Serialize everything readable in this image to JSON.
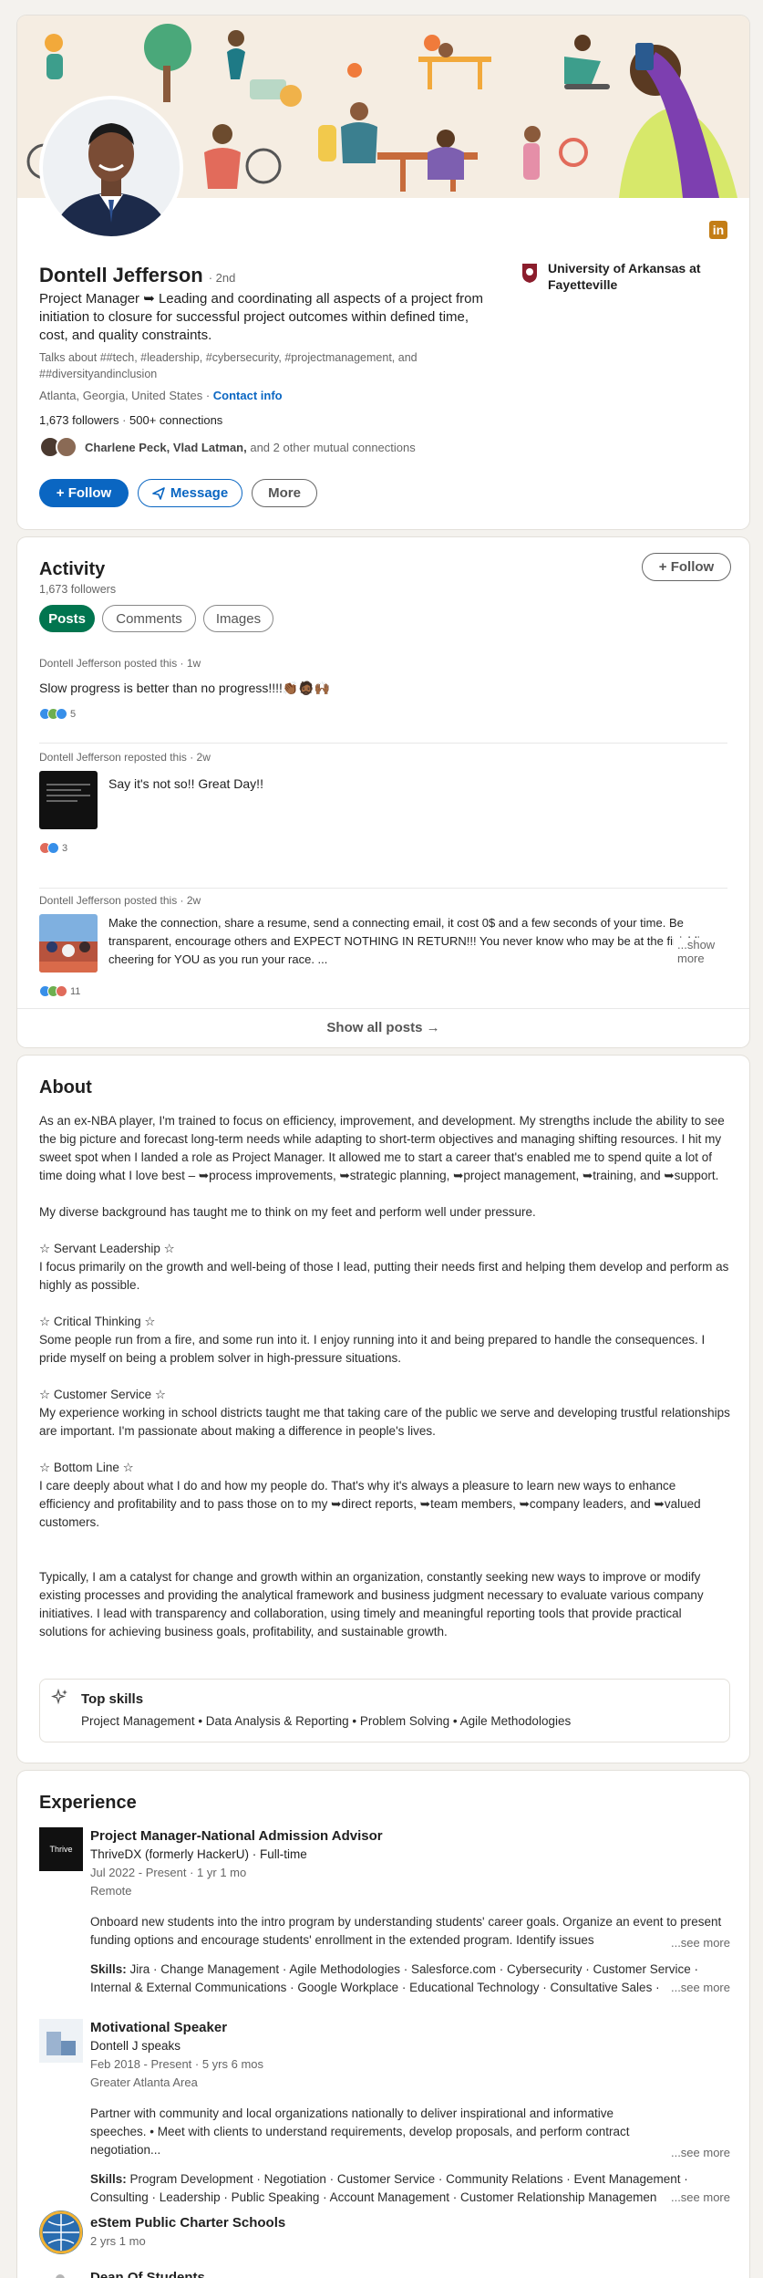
{
  "profile": {
    "name": "Dontell Jefferson",
    "degree": "· 2nd",
    "headline": "Project Manager ➥ Leading and coordinating all aspects of a project from initiation to closure for successful project outcomes within defined time, cost, and quality constraints.",
    "talks_about": "Talks about ##tech, #leadership, #cybersecurity, #projectmanagement, and ##diversityandinclusion",
    "location": "Atlanta, Georgia, United States",
    "sep": " · ",
    "contact": "Contact info",
    "followers": "1,673 followers",
    "connections": "500+ connections",
    "mutual_names": "Charlene Peck, Vlad Latman,",
    "mutual_rest": " and 2 other mutual connections",
    "school": "University of Arkansas at Fayetteville",
    "follow_button": "+ Follow",
    "message_button": "Message",
    "more_button": "More",
    "linkedin_badge": "in"
  },
  "activity": {
    "title": "Activity",
    "followers": "1,673 followers",
    "follow_button": "+ Follow",
    "tabs": [
      "Posts",
      "Comments",
      "Images"
    ],
    "posts": [
      {
        "meta": "Dontell Jefferson posted this · 1w",
        "text": "Slow progress is better than no progress!!!!👏🏾🧔🏾🙌🏾",
        "count": "5"
      },
      {
        "meta": "Dontell Jefferson reposted this · 2w",
        "text": "Say it's not so!! Great Day!!",
        "count": "3"
      },
      {
        "meta": "Dontell Jefferson posted this · 2w",
        "text": "Make the connection, share a resume, send a connecting email, it cost 0$ and a few seconds of your time. Be transparent, encourage others and EXPECT NOTHING IN RETURN!!! You never know who may be at the finishline cheering for YOU as you run your race. ...",
        "see_more": "...show more",
        "count": "11"
      }
    ],
    "show_all": "Show all posts →"
  },
  "about": {
    "title": "About",
    "p1": "As an ex-NBA player, I'm trained to focus on efficiency, improvement, and development. My strengths include the ability to see the big picture and forecast long-term needs while adapting to short-term objectives and managing shifting resources. I hit my sweet spot when I landed a role as Project Manager. It allowed me to start a career that's enabled me to spend quite a lot of time doing what I love best – ➥process improvements, ➥strategic planning, ➥project management, ➥training, and ➥support.",
    "p2": "My diverse background has taught me to think on my feet and perform well under pressure.",
    "h3": "☆ Servant Leadership ☆",
    "p3": "I focus primarily on the growth and well-being of those I lead, putting their needs first and helping them develop and perform as highly as possible.",
    "h4": "☆ Critical Thinking ☆",
    "p4": "Some people run from a fire, and some run into it. I enjoy running into it and being prepared to handle the consequences. I pride myself on being a problem solver in high-pressure situations.",
    "h5": "☆ Customer Service ☆",
    "p5": "My experience working in school districts taught me that taking care of the public we serve and developing trustful relationships are important. I'm passionate about making a difference in people's lives.",
    "h6": "☆ Bottom Line ☆",
    "p6": "I care deeply about what I do and how my people do. That's why it's always a pleasure to learn new ways to enhance efficiency and profitability and to pass those on to my ➥direct reports, ➥team members, ➥company leaders, and ➥valued customers.",
    "p7": "Typically, I am a catalyst for change and growth within an organization, constantly seeking new ways to improve or modify existing processes and providing the analytical framework and business judgment necessary to evaluate various company initiatives. I lead with transparency and collaboration, using timely and meaningful reporting tools that provide practical solutions for achieving business goals, profitability, and sustainable growth.",
    "top_skills_title": "Top skills",
    "top_skills": "Project Management • Data Analysis & Reporting • Problem Solving • Agile Methodologies"
  },
  "experience": {
    "title": "Experience",
    "items": [
      {
        "logo_text": "Thrive",
        "title": "Project Manager-National Admission Advisor",
        "company": "ThriveDX (formerly HackerU) · Full-time",
        "dates": "Jul 2022 - Present · 1 yr 1 mo",
        "location": "Remote",
        "desc": "Onboard new students into the intro program by understanding students' career goals. Organize an event to present funding options and encourage students' enrollment in the extended program. Identify issues",
        "see_more": "...see more",
        "skills_label": "Skills:",
        "skills": " Jira · Change Management · Agile Methodologies · Salesforce.com · Cybersecurity · Customer Service · Internal & External Communications · Google Workplace · Educational Technology · Consultative Sales ·",
        "skills_more": "...see more"
      },
      {
        "title": "Motivational Speaker",
        "company": "Dontell J speaks",
        "dates": "Feb 2018 - Present · 5 yrs 6 mos",
        "location": "Greater Atlanta Area",
        "desc": "Partner with community and local organizations nationally to deliver inspirational and informative speeches. • Meet with clients to understand requirements, develop proposals, and perform contract negotiation...",
        "see_more": "...see more",
        "skills_label": "Skills:",
        "skills": " Program Development · Negotiation · Customer Service · Community Relations · Event Management · Consulting · Leadership · Public Speaking · Account Management · Customer Relationship Managemen",
        "skills_more": "...see more"
      },
      {
        "title": "eStem Public Charter Schools",
        "dates": "2 yrs 1 mo"
      },
      {
        "title": "Dean Of Students"
      }
    ]
  },
  "colors": {
    "accent": "#0a66c2",
    "green": "#01754f",
    "banner_bg": "#f5ede2",
    "linkedin": "#c37d16"
  }
}
